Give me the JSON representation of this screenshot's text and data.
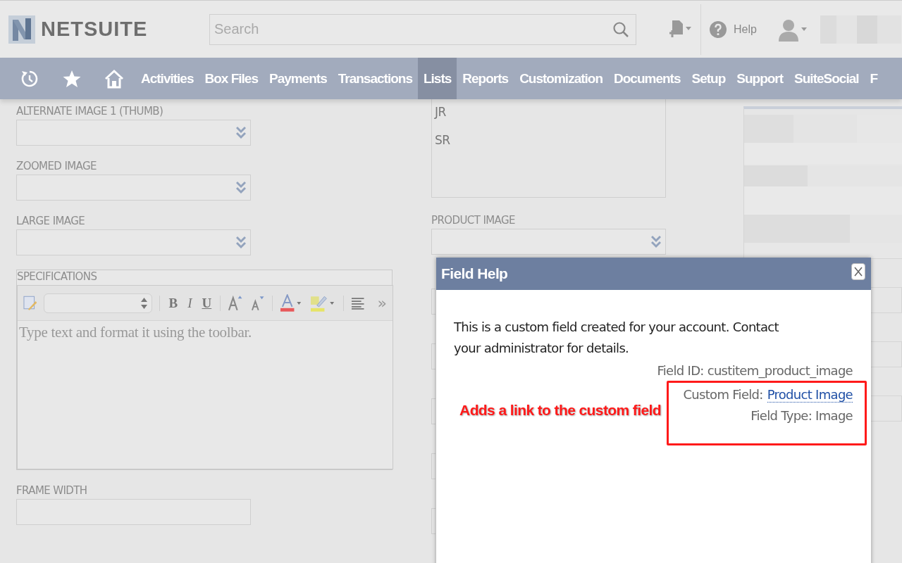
{
  "header": {
    "logo_text": "NETSUITE",
    "search": {
      "placeholder": "Search"
    },
    "help_label": "Help"
  },
  "nav": {
    "tabs": [
      {
        "label": "Activities",
        "selected": false
      },
      {
        "label": "Box Files",
        "selected": false
      },
      {
        "label": "Payments",
        "selected": false
      },
      {
        "label": "Transactions",
        "selected": false
      },
      {
        "label": "Lists",
        "selected": true
      },
      {
        "label": "Reports",
        "selected": false
      },
      {
        "label": "Customization",
        "selected": false
      },
      {
        "label": "Documents",
        "selected": false
      },
      {
        "label": "Setup",
        "selected": false
      },
      {
        "label": "Support",
        "selected": false
      },
      {
        "label": "SuiteSocial",
        "selected": false
      },
      {
        "label": "F",
        "selected": false
      }
    ]
  },
  "left_column": {
    "fields": [
      {
        "kind": "select",
        "label": "ALTERNATE IMAGE 1 (THUMB)"
      },
      {
        "kind": "select",
        "label": "ZOOMED IMAGE"
      },
      {
        "kind": "select",
        "label": "LARGE IMAGE"
      },
      {
        "kind": "editor",
        "label": "SPECIFICATIONS",
        "placeholder": "Type text and format it using the toolbar.",
        "toolbar_buttons": [
          "B",
          "I",
          "U"
        ],
        "more": "»"
      },
      {
        "kind": "text",
        "label": "FRAME WIDTH"
      }
    ]
  },
  "middle_column": {
    "list_options": [
      "JR",
      "SR"
    ],
    "fields": [
      {
        "kind": "select",
        "label": "PRODUCT IMAGE"
      }
    ]
  },
  "dialog": {
    "title": "Field Help",
    "message": "This is a custom field created for your account. Contact your administrator for details.",
    "field_id": "Field ID: custitem_product_image",
    "custom_field_label": "Custom Field:",
    "custom_field_link": "Product Image",
    "field_type": "Field Type: Image"
  },
  "annotation": {
    "text": "Adds a link to the custom field"
  }
}
